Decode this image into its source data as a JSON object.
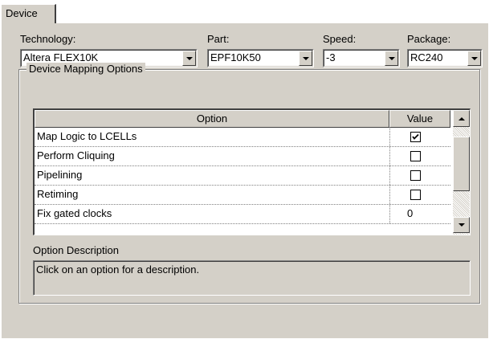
{
  "tab": {
    "label": "Device"
  },
  "fields": {
    "technology": {
      "label": "Technology:",
      "value": "Altera FLEX10K"
    },
    "part": {
      "label": "Part:",
      "value": "EPF10K50"
    },
    "speed": {
      "label": "Speed:",
      "value": "-3"
    },
    "package": {
      "label": "Package:",
      "value": "RC240"
    }
  },
  "mapping": {
    "title": "Device Mapping Options",
    "columns": {
      "option": "Option",
      "value": "Value"
    },
    "rows": [
      {
        "option": "Map Logic to LCELLs",
        "type": "checkbox",
        "checked": true
      },
      {
        "option": "Perform Cliquing",
        "type": "checkbox",
        "checked": false
      },
      {
        "option": "Pipelining",
        "type": "checkbox",
        "checked": false
      },
      {
        "option": "Retiming",
        "type": "checkbox",
        "checked": false
      },
      {
        "option": "Fix gated clocks",
        "type": "number",
        "value": "0"
      }
    ]
  },
  "description": {
    "label": "Option Description",
    "text": "Click on an option for a description."
  }
}
